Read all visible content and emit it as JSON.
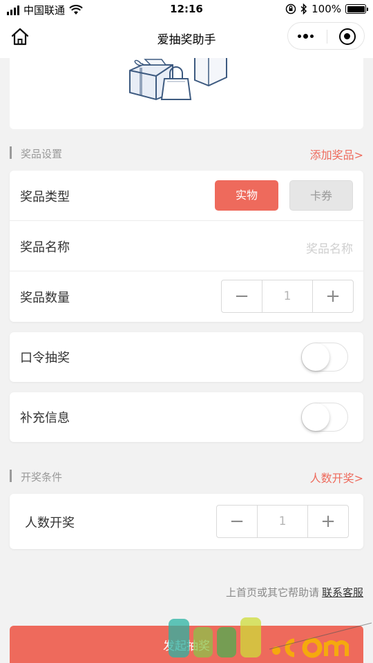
{
  "status_bar": {
    "carrier": "中国联通",
    "time": "12:16",
    "battery": "100%",
    "battery_level": 1.0
  },
  "nav": {
    "title": "爱抽奖助手",
    "home_icon": "home-icon",
    "more_icon": "more-icon",
    "close_icon": "target-icon"
  },
  "prize_section": {
    "title": "奖品设置",
    "link": "添加奖品>",
    "type_label": "奖品类型",
    "type_options": [
      "实物",
      "卡券"
    ],
    "type_selected": "实物",
    "name_label": "奖品名称",
    "name_placeholder": "奖品名称",
    "qty_label": "奖品数量",
    "qty_value": "1",
    "minus": "−",
    "plus": "+"
  },
  "toggles": {
    "password_draw": {
      "label": "口令抽奖",
      "on": false
    },
    "extra_info": {
      "label": "补充信息",
      "on": false
    }
  },
  "draw_condition": {
    "title": "开奖条件",
    "link": "人数开奖>",
    "count_label": "人数开奖",
    "count_value": "1",
    "minus": "−",
    "plus": "+"
  },
  "help": {
    "text": "上首页或其它帮助请",
    "link": "联系客服"
  },
  "submit": {
    "label": "发起抽奖"
  },
  "colors": {
    "accent": "#ee6a5c",
    "page_bg": "#f2f2f2"
  }
}
